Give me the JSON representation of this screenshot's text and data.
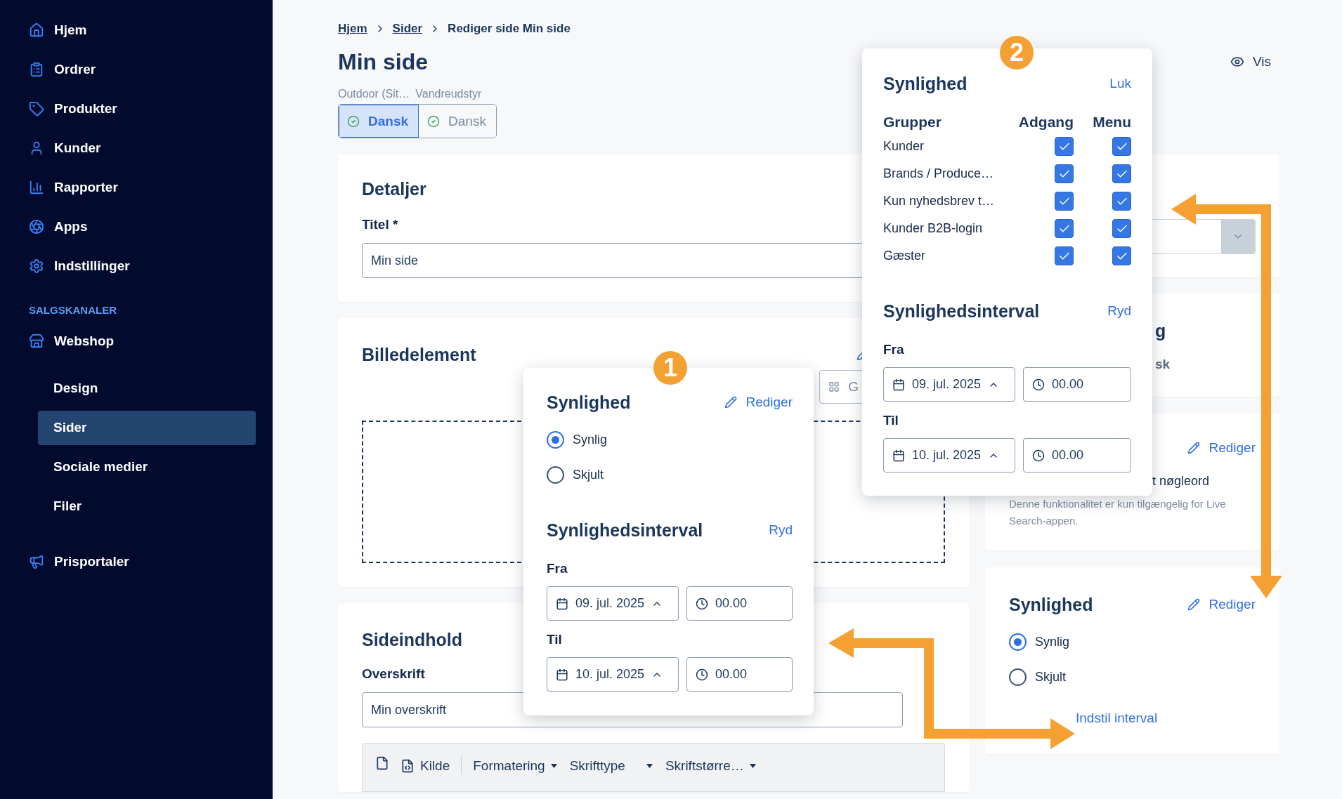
{
  "sidebar": {
    "main_items": [
      {
        "label": "Hjem",
        "selected": false
      },
      {
        "label": "Ordrer",
        "selected": false
      },
      {
        "label": "Produkter",
        "selected": false
      },
      {
        "label": "Kunder",
        "selected": false
      },
      {
        "label": "Rapporter",
        "selected": false
      },
      {
        "label": "Apps",
        "selected": false
      },
      {
        "label": "Indstillinger",
        "selected": false
      }
    ],
    "section_title": "SALGSKANALER",
    "channel": {
      "label": "Webshop"
    },
    "sub_items": [
      {
        "label": "Design",
        "selected": false
      },
      {
        "label": "Sider",
        "selected": true
      },
      {
        "label": "Sociale medier",
        "selected": false
      },
      {
        "label": "Filer",
        "selected": false
      }
    ],
    "bottom_item": {
      "label": "Prisportaler"
    }
  },
  "breadcrumb": [
    {
      "label": "Hjem",
      "kind": "link"
    },
    {
      "label": "Sider",
      "kind": "link"
    },
    {
      "label": "Rediger side Min side",
      "kind": "current"
    }
  ],
  "page": {
    "title": "Min side",
    "context": [
      "Outdoor (Sit…",
      "Vandreudstyr"
    ],
    "languages": [
      {
        "label": "Dansk",
        "selected": true
      },
      {
        "label": "Dansk",
        "selected": false
      }
    ],
    "view_button": "Vis"
  },
  "details_card": {
    "title": "Detaljer",
    "field_label": "Titel *",
    "field_value": "Min side"
  },
  "image_card": {
    "title": "Billedelement",
    "toolbar_button": "G"
  },
  "content_card": {
    "title": "Sideindhold",
    "field_label": "Overskrift",
    "field_value": "Min overskrift",
    "editor_toolbar": [
      {
        "kind": "document"
      },
      {
        "kind": "source",
        "label": "Kilde"
      },
      {
        "kind": "dropdown",
        "label": "Formatering"
      },
      {
        "kind": "wide_dropdown",
        "label": "Skrifttype"
      },
      {
        "kind": "dropdown",
        "label": "Skriftstørre…"
      }
    ]
  },
  "language_card": {
    "title": "g",
    "value": "sk"
  },
  "search_card": {
    "edit": "Rediger",
    "keyword_label": "t nøgleord",
    "note": "Denne funktionalitet er kun tilgængelig for Live Search-appen."
  },
  "visibility_card": {
    "title": "Synlighed",
    "edit": "Rediger",
    "options": [
      {
        "label": "Synlig",
        "selected": true
      },
      {
        "label": "Skjult",
        "selected": false
      }
    ],
    "interval_link": "Indstil interval"
  },
  "popover_1": {
    "badge": "1",
    "title": "Synlighed",
    "edit": "Rediger",
    "options": [
      {
        "label": "Synlig",
        "selected": true
      },
      {
        "label": "Skjult",
        "selected": false
      }
    ],
    "interval": {
      "title": "Synlighedsinterval",
      "clear": "Ryd",
      "from_label": "Fra",
      "from_date": "09. jul. 2025",
      "from_time": "00.00",
      "to_label": "Til",
      "to_date": "10. jul. 2025",
      "to_time": "00.00"
    }
  },
  "popover_2": {
    "badge": "2",
    "title": "Synlighed",
    "close": "Luk",
    "columns": [
      "Grupper",
      "Adgang",
      "Menu"
    ],
    "groups": [
      {
        "name": "Kunder",
        "access": true,
        "menu": true
      },
      {
        "name": "Brands / Produce…",
        "access": true,
        "menu": true
      },
      {
        "name": "Kun nyhedsbrev t…",
        "access": true,
        "menu": true
      },
      {
        "name": "Kunder B2B-login",
        "access": true,
        "menu": true
      },
      {
        "name": "Gæster",
        "access": true,
        "menu": true
      }
    ],
    "interval": {
      "title": "Synlighedsinterval",
      "clear": "Ryd",
      "from_label": "Fra",
      "from_date": "09. jul. 2025",
      "from_time": "00.00",
      "to_label": "Til",
      "to_date": "10. jul. 2025",
      "to_time": "00.00"
    }
  }
}
